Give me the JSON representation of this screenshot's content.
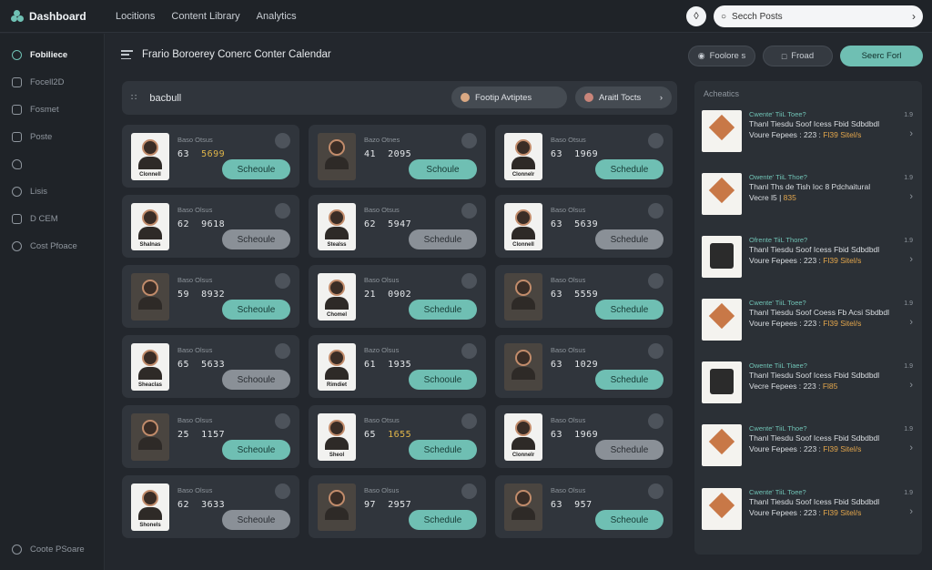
{
  "app": {
    "title": "Dashboard"
  },
  "topnav": [
    "Locitions",
    "Content Library",
    "Analytics"
  ],
  "search": {
    "placeholder": "Secch Posts"
  },
  "sidebar": {
    "items": [
      {
        "label": "Fobiliece",
        "icon": "circle-icon"
      },
      {
        "label": "Focell2D",
        "icon": "inbox-icon"
      },
      {
        "label": "Fosmet",
        "icon": "stack-icon"
      },
      {
        "label": "Poste",
        "icon": "calendar-icon"
      },
      {
        "label": "",
        "icon": "heart-icon"
      },
      {
        "label": "Lisis",
        "icon": "user-icon"
      },
      {
        "label": "D CEM",
        "icon": "shield-icon"
      },
      {
        "label": "Cost Pfoace",
        "icon": "people-icon"
      }
    ],
    "bottom": {
      "label": "Coote PSoare",
      "icon": "gear-icon"
    }
  },
  "page": {
    "title": "Frario Boroerey Conerc Conter Calendar"
  },
  "header_buttons": {
    "btn1": "Foolore s",
    "btn2": "Froad",
    "btn3": "Seerc Forl"
  },
  "filterbar": {
    "title": "bacbull",
    "chip1": "Footip Avtiptes",
    "chip2": "Araitl Tocts"
  },
  "cards": [
    {
      "label": "Baso Otsus",
      "n1": "63",
      "n2": "5699",
      "n2_highlight": true,
      "caption": "Clonnell",
      "photo": false,
      "button": "Scheoule",
      "button_style": "teal"
    },
    {
      "label": "Bazo Otnes",
      "n1": "41",
      "n2": "2095",
      "n2_highlight": false,
      "caption": "",
      "photo": true,
      "button": "Schoule",
      "button_style": "teal"
    },
    {
      "label": "Baso Otsus",
      "n1": "63",
      "n2": "1969",
      "n2_highlight": false,
      "caption": "Clonnelr",
      "photo": false,
      "button": "Schedule",
      "button_style": "teal"
    },
    {
      "label": "Baso Olsus",
      "n1": "62",
      "n2": "9618",
      "n2_highlight": false,
      "caption": "Shalnas",
      "photo": false,
      "button": "Scheoule",
      "button_style": "gray"
    },
    {
      "label": "Baso Otsus",
      "n1": "62",
      "n2": "5947",
      "n2_highlight": false,
      "caption": "Stealss",
      "photo": false,
      "button": "Schedule",
      "button_style": "gray"
    },
    {
      "label": "Baso Olsus",
      "n1": "63",
      "n2": "5639",
      "n2_highlight": false,
      "caption": "Clonnell",
      "photo": false,
      "button": "Schedule",
      "button_style": "gray"
    },
    {
      "label": "Baso Olsus",
      "n1": "59",
      "n2": "8932",
      "n2_highlight": false,
      "caption": "",
      "photo": true,
      "button": "Scheoule",
      "button_style": "teal"
    },
    {
      "label": "Baso Olsus",
      "n1": "21",
      "n2": "0902",
      "n2_highlight": false,
      "caption": "Chomel",
      "photo": false,
      "button": "Schedule",
      "button_style": "teal"
    },
    {
      "label": "Baso Olsus",
      "n1": "63",
      "n2": "5559",
      "n2_highlight": false,
      "caption": "",
      "photo": true,
      "button": "Schedule",
      "button_style": "teal"
    },
    {
      "label": "Baso Olsus",
      "n1": "65",
      "n2": "5633",
      "n2_highlight": false,
      "caption": "Sheaclas",
      "photo": false,
      "button": "Schooule",
      "button_style": "gray"
    },
    {
      "label": "Bazo Olsus",
      "n1": "61",
      "n2": "1935",
      "n2_highlight": false,
      "caption": "Rimdiet",
      "photo": false,
      "button": "Schooule",
      "button_style": "teal"
    },
    {
      "label": "Baso Olsus",
      "n1": "63",
      "n2": "1029",
      "n2_highlight": false,
      "caption": "",
      "photo": true,
      "button": "Schedule",
      "button_style": "teal"
    },
    {
      "label": "Baso Olsus",
      "n1": "25",
      "n2": "1157",
      "n2_highlight": false,
      "caption": "",
      "photo": true,
      "button": "Scheoule",
      "button_style": "teal"
    },
    {
      "label": "Baso Otsus",
      "n1": "65",
      "n2": "1655",
      "n2_highlight": true,
      "caption": "Sheol",
      "photo": false,
      "button": "Schedule",
      "button_style": "teal"
    },
    {
      "label": "Baso Olsus",
      "n1": "63",
      "n2": "1969",
      "n2_highlight": false,
      "caption": "Clonnelr",
      "photo": false,
      "button": "Schedule",
      "button_style": "gray"
    },
    {
      "label": "Baso Olsus",
      "n1": "62",
      "n2": "3633",
      "n2_highlight": false,
      "caption": "Shonels",
      "photo": false,
      "button": "Scheoule",
      "button_style": "gray"
    },
    {
      "label": "Baso Olsus",
      "n1": "97",
      "n2": "2957",
      "n2_highlight": false,
      "caption": "",
      "photo": true,
      "button": "Schedule",
      "button_style": "teal"
    },
    {
      "label": "Baso Olsus",
      "n1": "63",
      "n2": "957",
      "n2_highlight": false,
      "caption": "",
      "photo": true,
      "button": "Scheoule",
      "button_style": "teal"
    }
  ],
  "right_panel": {
    "title": "Acheatics",
    "items": [
      {
        "l1": "Cwente' TiiL Toee?",
        "l2": "Thanl Tiesdu  Soof Icess Fbid Sdbdbdl",
        "l3a": "Voure Fepees : 223 :",
        "l3b": "Fl39 Sitel/s",
        "num": "1.9"
      },
      {
        "l1": "Owente' TiiL Thoe?",
        "l2": "Thanl Ths de   Tish Ioc 8 Pdchaitural",
        "l3a": "Vecre l5  |",
        "l3b": "835",
        "num": "1.9"
      },
      {
        "l1": "Ofrente TiiL Thore?",
        "l2": "Thanl Tiesdu  Soof Icess Fbid Sdbdbdl",
        "l3a": "Voure Fepees : 223 :",
        "l3b": "Fl39 Sitel/s",
        "num": "1.9"
      },
      {
        "l1": "Cwente' TiiL Toee?",
        "l2": "Thanl Tiesdu  Soof Coess Fb Acsi Sbdbdl",
        "l3a": "Voure Fepees : 223 :",
        "l3b": "Fl39 Sitel/s",
        "num": "1.9"
      },
      {
        "l1": "Owente TiiL Tiaee?",
        "l2": "Thanl Tiesdu  Soof Icess Fbid Sdbdbdl",
        "l3a": "Vecre Fepees : 223 :",
        "l3b": "Fl85",
        "num": "1.9"
      },
      {
        "l1": "Cwente' TiiL Thoe?",
        "l2": "Thanl Tiesdu  Soof Icess Fbid Sdbdbdl",
        "l3a": "Voure Fepees : 223 :",
        "l3b": "Fl39 Sitel/s",
        "num": "1.9"
      },
      {
        "l1": "Cwente' TiiL Toee?",
        "l2": "Thanl Tiesdu  Soof Icess Fbid Sdbdbdl",
        "l3a": "Voure Fepees : 223 :",
        "l3b": "Fl39 Sitel/s",
        "num": "1.9"
      }
    ]
  }
}
